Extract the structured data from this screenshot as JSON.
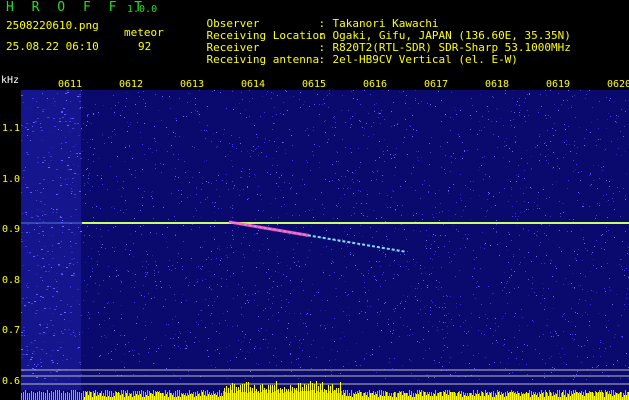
{
  "header": {
    "app_title": "H R O F F T",
    "app_version": "1.0.0",
    "file_name": "2508220610.png",
    "date_time": "25.08.22 06:10",
    "mode_label": "meteor",
    "count_value": "92"
  },
  "station_info": [
    {
      "label": "Observer",
      "value": "Takanori Kawachi"
    },
    {
      "label": "Receiving Location",
      "value": "Ogaki, Gifu, JAPAN (136.60E, 35.35N)"
    },
    {
      "label": "Receiver",
      "value": "R820T2(RTL-SDR) SDR-Sharp 53.1000MHz"
    },
    {
      "label": "Receiving antenna",
      "value": "2el-HB9CV Vertical (el. E-W)"
    }
  ],
  "separator": ":",
  "colors": {
    "header_green": "#22dd22",
    "text_yellow": "#ffff00",
    "background_navy": "#0a0a6e",
    "carrier_line": "#ccff66",
    "meteor_trail": "#ff66cc",
    "activity_bar": "#ffff00"
  },
  "chart_data": {
    "type": "heatmap",
    "title": "",
    "ylabel": "kHz",
    "x_ticks": [
      "0611",
      "0612",
      "0613",
      "0614",
      "0615",
      "0616",
      "0617",
      "0618",
      "0619",
      "0620"
    ],
    "y_ticks": [
      "1.1",
      "1.0",
      "0.9",
      "0.8",
      "0.7",
      "0.6"
    ],
    "ylim": [
      0.58,
      1.2
    ],
    "grid": false,
    "features": [
      {
        "name": "carrier",
        "freq_khz": 0.91,
        "time_start": "0611",
        "time_end": "0620"
      },
      {
        "name": "meteor_echo",
        "start": {
          "time": "0614",
          "freq_khz": 0.91
        },
        "end": {
          "time": "0616.5",
          "freq_khz": 0.855
        }
      }
    ]
  }
}
